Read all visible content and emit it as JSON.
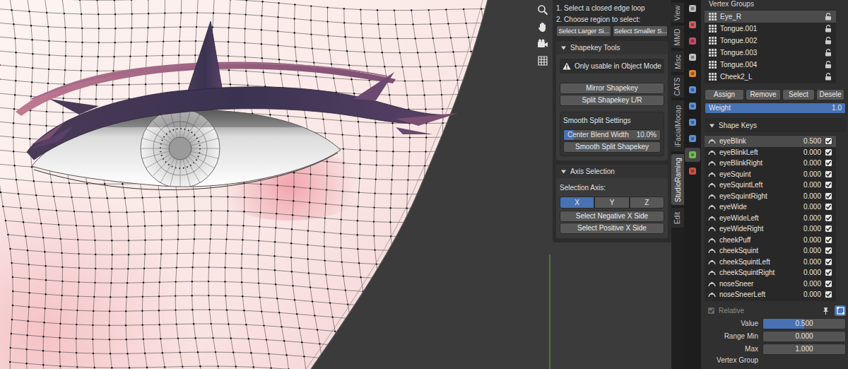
{
  "sidebar": {
    "steps": [
      "1. Select a closed edge loop",
      "2. Choose region to select:"
    ],
    "region_buttons": [
      "Select Larger Si...",
      "Select Smaller S..."
    ],
    "shapekey_tools": {
      "title": "Shapekey Tools",
      "expanded": true,
      "warning": "Only usable in Object Mode",
      "buttons": [
        "Mirror Shapekey",
        "Split Shapekey L/R"
      ],
      "smooth_split": {
        "title": "Smooth Split Settings",
        "slider": {
          "label": "Center Blend Width",
          "reading": "10.0%",
          "level": 0.1
        },
        "button": "Smooth Split Shapekey"
      }
    },
    "axis_selection": {
      "title": "Axis Selection",
      "expanded": true,
      "label": "Selection Axis:",
      "axes": [
        {
          "label": "X",
          "selected": true
        },
        {
          "label": "Y",
          "selected": false
        },
        {
          "label": "Z",
          "selected": false
        }
      ],
      "buttons": [
        "Select Negative X Side",
        "Select Positive X Side"
      ]
    }
  },
  "sidebar_tabs": [
    {
      "label": "View",
      "selected": false
    },
    {
      "label": "MMD",
      "selected": false
    },
    {
      "label": "Misc",
      "selected": false
    },
    {
      "label": "CATS",
      "selected": false
    },
    {
      "label": "iFacialMocap",
      "selected": false
    },
    {
      "label": "StudioRaming",
      "selected": true
    },
    {
      "label": "Edit",
      "selected": false
    }
  ],
  "properties_tabs": [
    {
      "selected": false,
      "color": "#b8b8b8"
    },
    {
      "selected": false,
      "color": "#cf5e5e"
    },
    {
      "selected": false,
      "color": "#c64a6a"
    },
    {
      "selected": false,
      "color": "#bfbfbf"
    },
    {
      "selected": false,
      "color": "#e0812d"
    },
    {
      "selected": false,
      "color": "#5b8fd6"
    },
    {
      "selected": false,
      "color": "#5b8fd6"
    },
    {
      "selected": false,
      "color": "#5b8fd6"
    },
    {
      "selected": false,
      "color": "#5b8fd6"
    },
    {
      "selected": true,
      "color": "#6fbf4a"
    },
    {
      "selected": false,
      "color": "#d0503f"
    }
  ],
  "vertex_groups": {
    "title": "Vertex Groups",
    "items": [
      {
        "name": "Eye_R",
        "selected": true,
        "locked": false
      },
      {
        "name": "Tongue.001",
        "selected": false,
        "locked": false
      },
      {
        "name": "Tongue.002",
        "selected": false,
        "locked": false
      },
      {
        "name": "Tongue.003",
        "selected": false,
        "locked": false
      },
      {
        "name": "Tongue.004",
        "selected": false,
        "locked": false
      },
      {
        "name": "Cheek2_L",
        "selected": false,
        "locked": false
      }
    ],
    "buttons": [
      "Assign",
      "Remove",
      "Select",
      "Desele"
    ],
    "weight": {
      "label": "Weight",
      "reading": "1.0",
      "level": 1
    }
  },
  "shape_keys": {
    "title": "Shape Keys",
    "expanded": true,
    "items": [
      {
        "name": "eyeBlink",
        "value": "0.500",
        "checked": true,
        "selected": true
      },
      {
        "name": "eyeBlinkLeft",
        "value": "0.000",
        "checked": true,
        "selected": false
      },
      {
        "name": "eyeBlinkRight",
        "value": "0.000",
        "checked": true,
        "selected": false
      },
      {
        "name": "eyeSquint",
        "value": "0.000",
        "checked": true,
        "selected": false
      },
      {
        "name": "eyeSquintLeft",
        "value": "0.000",
        "checked": true,
        "selected": false
      },
      {
        "name": "eyeSquintRight",
        "value": "0.000",
        "checked": true,
        "selected": false
      },
      {
        "name": "eyeWide",
        "value": "0.000",
        "checked": true,
        "selected": false
      },
      {
        "name": "eyeWideLeft",
        "value": "0.000",
        "checked": true,
        "selected": false
      },
      {
        "name": "eyeWideRight",
        "value": "0.000",
        "checked": true,
        "selected": false
      },
      {
        "name": "cheekPuff",
        "value": "0.000",
        "checked": true,
        "selected": false
      },
      {
        "name": "cheekSquint",
        "value": "0.000",
        "checked": true,
        "selected": false
      },
      {
        "name": "cheekSquintLeft",
        "value": "0.000",
        "checked": true,
        "selected": false
      },
      {
        "name": "cheekSquintRight",
        "value": "0.000",
        "checked": true,
        "selected": false
      },
      {
        "name": "noseSneer",
        "value": "0.000",
        "checked": true,
        "selected": false
      },
      {
        "name": "noseSneerLeft",
        "value": "0.000",
        "checked": true,
        "selected": false
      }
    ],
    "relative": {
      "label": "Relative",
      "checked": true,
      "disabled": true
    },
    "toggles": [
      {
        "selected": false
      },
      {
        "selected": true
      }
    ],
    "value": {
      "label": "Value",
      "reading": "0.500",
      "level": 0.5
    },
    "range_min": {
      "label": "Range Min",
      "reading": "0.000"
    },
    "max": {
      "label": "Max",
      "reading": "1.000"
    },
    "vertex_group_label": "Vertex Group"
  }
}
